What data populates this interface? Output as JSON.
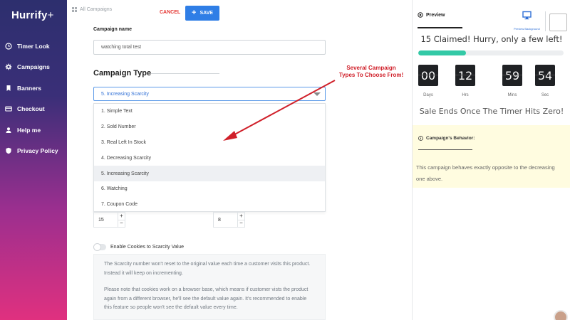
{
  "app": {
    "logo_text": "Hurrify",
    "logo_suffix": "+"
  },
  "sidebar": {
    "items": [
      {
        "label": "Timer Look",
        "icon": "clock-icon"
      },
      {
        "label": "Campaigns",
        "icon": "gear-icon"
      },
      {
        "label": "Banners",
        "icon": "bookmark-icon"
      },
      {
        "label": "Checkout",
        "icon": "credit-card-icon"
      },
      {
        "label": "Help me",
        "icon": "user-icon"
      },
      {
        "label": "Privacy Policy",
        "icon": "shield-icon"
      }
    ]
  },
  "header": {
    "breadcrumb": "All Campaigns",
    "cancel_label": "CANCEL",
    "save_label": "SAVE",
    "save_color": "#2f7ee6",
    "cancel_color": "#e53935"
  },
  "form": {
    "campaign_name_label": "Campaign name",
    "campaign_name_value": "watching total test",
    "campaign_type_title": "Campaign Type",
    "selected_type": "5. Increasing Scarcity",
    "options": [
      "1. Simple Text",
      "2. Sold Number",
      "3. Real Left In Stock",
      "4. Decreasing Scarcity",
      "5. Increasing Scarcity",
      "6. Watching",
      "7. Coupon Code"
    ],
    "stepper_left_value": "15",
    "stepper_right_value": "8",
    "stepper_plus": "+",
    "stepper_minus": "−",
    "cookie_toggle_label": "Enable Cookies to Scarcity Value",
    "info_paragraph_1": "The Scarcity number won't reset to the original value each time a customer visits this product. Instead it will keep on incrementing.",
    "info_paragraph_2": "Please note that cookies work on a browser base, which means if customer vists the product again from a different browser, he'll see the default value again. It's recommended to enable this feature so people won't see the default value every time."
  },
  "annotation": {
    "line1": "Several Campaign",
    "line2": "Types To Choose From!",
    "color": "#d0202a"
  },
  "preview": {
    "tab_label": "Preview",
    "preview_background_label": "Preview Background",
    "claimed_text": "15  Claimed! Hurry, only a few left!",
    "progress_fraction": 0.33,
    "progress_color": "#33c9a6",
    "timer": {
      "days": "00",
      "hours": "12",
      "mins": "59",
      "secs": "54",
      "days_label": "Days",
      "hours_label": "Hrs",
      "mins_label": "Mins",
      "secs_label": "Sec"
    },
    "sale_text": "Sale Ends Once The Timer Hits Zero!",
    "behavior_title": "Campaign's Behavior:",
    "behavior_text_1": "This campaign behaves exactly opposite to the decreasing",
    "behavior_text_2": "one above."
  }
}
